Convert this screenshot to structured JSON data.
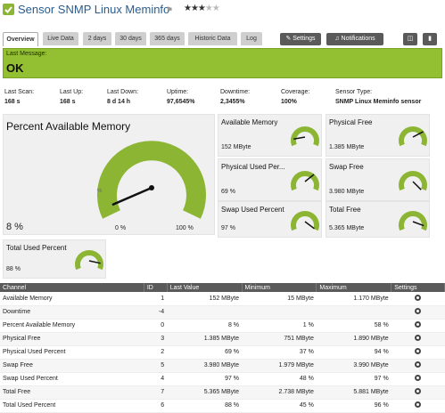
{
  "header": {
    "title": "Sensor SNMP Linux Meminfo",
    "priority_stars": 3,
    "max_stars": 5
  },
  "tabs": [
    "Overview",
    "Live Data",
    "2 days",
    "30 days",
    "365 days",
    "Historic Data",
    "Log"
  ],
  "buttons": {
    "settings": "Settings",
    "notifications": "Notifications"
  },
  "message": {
    "label": "Last Message:",
    "value": "OK"
  },
  "stats": [
    {
      "k": "Last Scan:",
      "v": "168 s"
    },
    {
      "k": "Last Up:",
      "v": "168 s"
    },
    {
      "k": "Last Down:",
      "v": "8 d 14 h"
    },
    {
      "k": "Uptime:",
      "v": "97,6545%"
    },
    {
      "k": "Downtime:",
      "v": "2,3455%"
    },
    {
      "k": "Coverage:",
      "v": "100%"
    },
    {
      "k": "Sensor Type:",
      "v": "SNMP Linux Meminfo sensor"
    }
  ],
  "big_gauge": {
    "name": "Percent Available Memory",
    "value": "8 %",
    "fraction": 0.08,
    "min_label": "0 %",
    "max_label": "100 %",
    "mid_label": "%"
  },
  "small_gauges": [
    {
      "name": "Available Memory",
      "value": "152 MByte",
      "fraction": 0.13
    },
    {
      "name": "Physical Free",
      "value": "1.385 MByte",
      "fraction": 0.73
    },
    {
      "name": "Physical Used Per...",
      "value": "69 %",
      "fraction": 0.69
    },
    {
      "name": "Swap Free",
      "value": "3.980 MByte",
      "fraction": 1.0
    },
    {
      "name": "Swap Used Percent",
      "value": "97 %",
      "fraction": 0.97
    },
    {
      "name": "Total Free",
      "value": "5.365 MByte",
      "fraction": 0.91
    },
    {
      "name": "Total Used Percent",
      "value": "88 %",
      "fraction": 0.88
    }
  ],
  "table": {
    "headers": [
      "Channel",
      "ID",
      "Last Value",
      "Minimum",
      "Maximum",
      "Settings"
    ],
    "rows": [
      [
        "Available Memory",
        "1",
        "152 MByte",
        "15 MByte",
        "1.170 MByte"
      ],
      [
        "Downtime",
        "-4",
        "",
        "",
        ""
      ],
      [
        "Percent Available Memory",
        "0",
        "8 %",
        "1 %",
        "58 %"
      ],
      [
        "Physical Free",
        "3",
        "1.385 MByte",
        "751 MByte",
        "1.890 MByte"
      ],
      [
        "Physical Used Percent",
        "2",
        "69 %",
        "37 %",
        "94 %"
      ],
      [
        "Swap Free",
        "5",
        "3.980 MByte",
        "1.979 MByte",
        "3.990 MByte"
      ],
      [
        "Swap Used Percent",
        "4",
        "97 %",
        "48 %",
        "97 %"
      ],
      [
        "Total Free",
        "7",
        "5.365 MByte",
        "2.738 MByte",
        "5.881 MByte"
      ],
      [
        "Total Used Percent",
        "6",
        "88 %",
        "45 %",
        "96 %"
      ]
    ]
  },
  "colors": {
    "ok_green": "#93bf33",
    "gauge_green": "#8cb534",
    "header_blue": "#2a5d8e"
  }
}
